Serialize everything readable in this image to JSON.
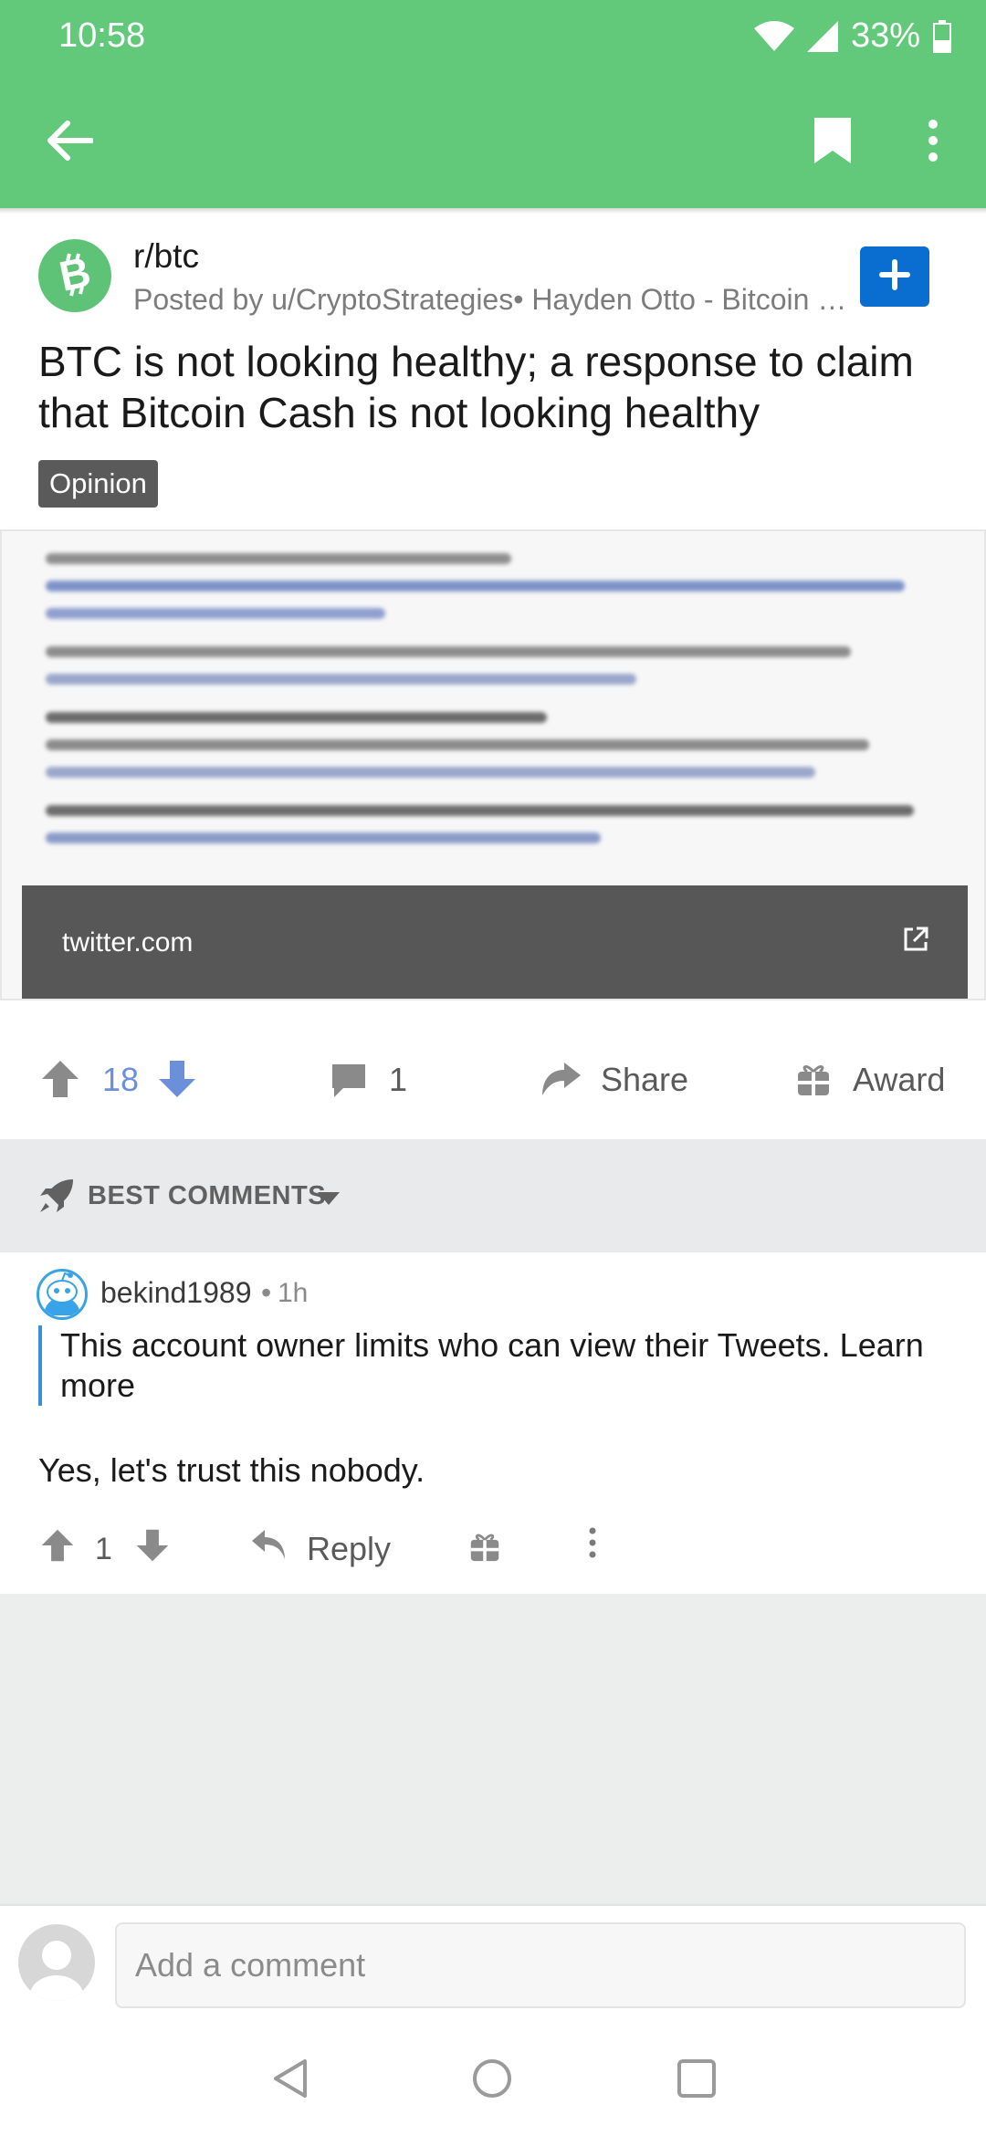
{
  "status_bar": {
    "time": "10:58",
    "battery": "33%"
  },
  "post": {
    "subreddit": "r/btc",
    "posted_by": "Posted by u/CryptoStrategies• Hayden Otto - Bitcoin B...",
    "title": "BTC is not looking healthy; a response to claim that Bitcoin Cash is not looking healthy",
    "flair": "Opinion",
    "link_domain": "twitter.com",
    "score": "18",
    "comment_count": "1",
    "share_label": "Share",
    "award_label": "Award"
  },
  "comments_header": {
    "sort_label": "BEST COMMENTS"
  },
  "comment": {
    "username": "bekind1989",
    "separator": "•",
    "age": "1h",
    "quote": "This account owner limits who can view their Tweets. Learn more",
    "body": "Yes, let's trust this nobody.",
    "score": "1",
    "reply_label": "Reply"
  },
  "composer": {
    "placeholder": "Add a comment"
  },
  "colors": {
    "header_green": "#62c97a",
    "join_blue": "#0a6ed1",
    "vote_blue": "#6b8fd8",
    "quote_bar": "#3c8fd6"
  },
  "icons": [
    "back-arrow-icon",
    "bookmark-icon",
    "more-vertical-icon",
    "bitcoin-cash-icon",
    "plus-icon",
    "external-link-icon",
    "upvote-icon",
    "downvote-icon",
    "comment-icon",
    "share-icon",
    "award-icon",
    "rocket-icon",
    "caret-down-icon",
    "snoo-avatar-icon",
    "reply-icon",
    "nav-back-icon",
    "nav-home-icon",
    "nav-recents-icon"
  ]
}
